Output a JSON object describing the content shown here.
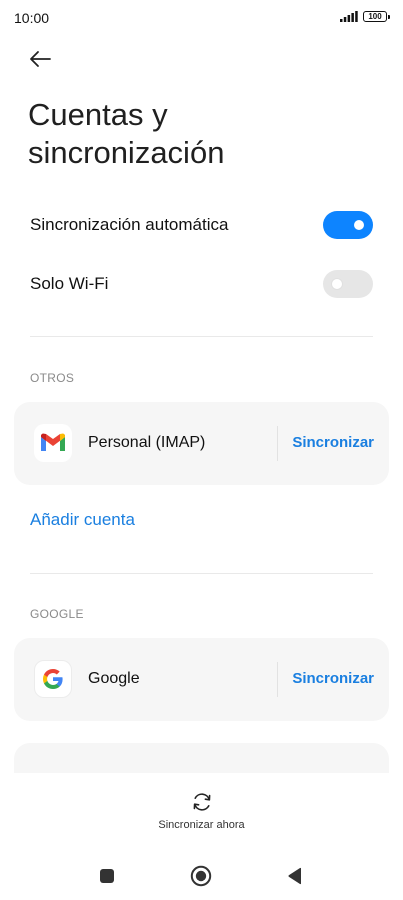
{
  "status_bar": {
    "time": "10:00",
    "battery": "100"
  },
  "page": {
    "title": "Cuentas y sincronización"
  },
  "settings": {
    "auto_sync": {
      "label": "Sincronización automática",
      "enabled": true
    },
    "wifi_only": {
      "label": "Solo Wi-Fi",
      "enabled": false
    }
  },
  "sections": {
    "otros": {
      "header": "OTROS",
      "account": {
        "name": "Personal (IMAP)",
        "icon": "gmail-icon",
        "action": "Sincronizar"
      },
      "add_account": "Añadir cuenta"
    },
    "google": {
      "header": "GOOGLE",
      "account": {
        "name": "Google",
        "icon": "google-icon",
        "action": "Sincronizar"
      }
    }
  },
  "bottom": {
    "sync_now": "Sincronizar ahora"
  },
  "colors": {
    "accent": "#0d84ff",
    "link": "#1a7fe0",
    "card": "#f6f6f6"
  }
}
